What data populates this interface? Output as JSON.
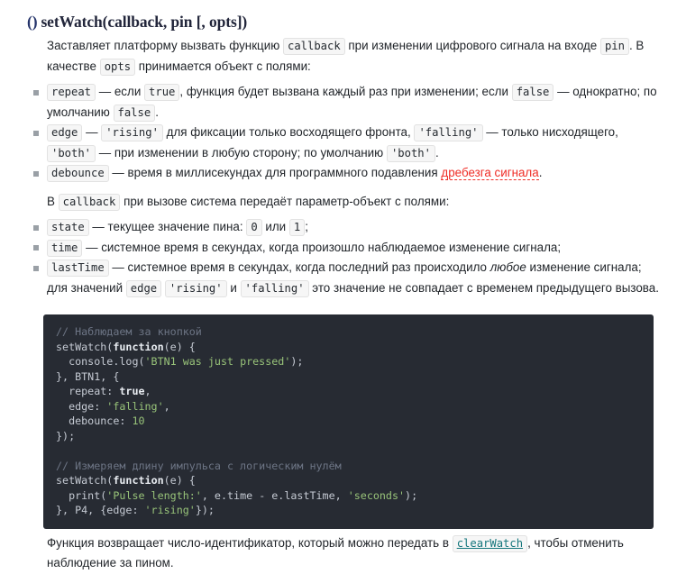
{
  "heading": {
    "paren": "()",
    "title": "setWatch(callback, pin [, opts])"
  },
  "intro": {
    "t1": "Заставляет платформу вызвать функцию ",
    "code_callback": "callback",
    "t2": " при изменении цифрового сигнала на входе ",
    "code_pin": "pin",
    "t3": ". В качестве ",
    "code_opts": "opts",
    "t4": " принимается объект с полями:"
  },
  "opts_list": [
    {
      "code": "repeat",
      "t1": " — если ",
      "code2": "true",
      "t2": ", функция будет вызвана каждый раз при изменении; если ",
      "code3": "false",
      "t3": " — однократно; по умолчанию ",
      "code4": "false",
      "t4": "."
    },
    {
      "code": "edge",
      "t1": " — ",
      "code2": "'rising'",
      "t2": " для фиксации только восходящего фронта, ",
      "code3": "'falling'",
      "t3": " — только нисходящего, ",
      "code4": "'both'",
      "t4": " — при изменении в любую сторону; по умолчанию ",
      "code5": "'both'",
      "t5": "."
    },
    {
      "code": "debounce",
      "t1": " — время в миллисекундах для программного подавления ",
      "link": "дребезга сигнала",
      "t2": "."
    }
  ],
  "callback_intro": {
    "t1": "В ",
    "code": "callback",
    "t2": " при вызове система передаёт параметр-объект с полями:"
  },
  "params_list": [
    {
      "code": "state",
      "t1": " — текущее значение пина: ",
      "code2": "0",
      "t2": " или ",
      "code3": "1",
      "t3": ";"
    },
    {
      "code": "time",
      "t1": " — системное время в секундах, когда произошло наблюдаемое изменение сигнала;"
    },
    {
      "code": "lastTime",
      "t1": " — системное время в секундах, когда последний раз происходило ",
      "em": "любое",
      "t2": " изменение сигнала; для значений ",
      "code2": "edge",
      "t3": " ",
      "code3": "'rising'",
      "t4": " и ",
      "code4": "'falling'",
      "t5": " это значение не совпадает с временем предыдущего вызова."
    }
  ],
  "code_block": {
    "lines": [
      [
        {
          "t": "// Наблюдаем за кнопкой",
          "c": "tok-com"
        }
      ],
      [
        {
          "t": "setWatch(",
          "c": "tok-pln"
        },
        {
          "t": "function",
          "c": "tok-kw"
        },
        {
          "t": "(e) {",
          "c": "tok-pln"
        }
      ],
      [
        {
          "t": "  console.log(",
          "c": "tok-pln"
        },
        {
          "t": "'BTN1 was just pressed'",
          "c": "tok-str"
        },
        {
          "t": ");",
          "c": "tok-pln"
        }
      ],
      [
        {
          "t": "}, BTN1, {",
          "c": "tok-pln"
        }
      ],
      [
        {
          "t": "  repeat: ",
          "c": "tok-pln"
        },
        {
          "t": "true",
          "c": "tok-kw"
        },
        {
          "t": ",",
          "c": "tok-pln"
        }
      ],
      [
        {
          "t": "  edge: ",
          "c": "tok-pln"
        },
        {
          "t": "'falling'",
          "c": "tok-str"
        },
        {
          "t": ",",
          "c": "tok-pln"
        }
      ],
      [
        {
          "t": "  debounce: ",
          "c": "tok-pln"
        },
        {
          "t": "10",
          "c": "tok-num"
        }
      ],
      [
        {
          "t": "});",
          "c": "tok-pln"
        }
      ],
      [
        {
          "t": "",
          "c": "tok-pln"
        }
      ],
      [
        {
          "t": "// Измеряем длину импульса с логическим нулём",
          "c": "tok-com"
        }
      ],
      [
        {
          "t": "setWatch(",
          "c": "tok-pln"
        },
        {
          "t": "function",
          "c": "tok-kw"
        },
        {
          "t": "(e) {",
          "c": "tok-pln"
        }
      ],
      [
        {
          "t": "  print(",
          "c": "tok-pln"
        },
        {
          "t": "'Pulse length:'",
          "c": "tok-str"
        },
        {
          "t": ", e.time - e.lastTime, ",
          "c": "tok-pln"
        },
        {
          "t": "'seconds'",
          "c": "tok-str"
        },
        {
          "t": ");",
          "c": "tok-pln"
        }
      ],
      [
        {
          "t": "}, P4, {edge: ",
          "c": "tok-pln"
        },
        {
          "t": "'rising'",
          "c": "tok-str"
        },
        {
          "t": "});",
          "c": "tok-pln"
        }
      ]
    ]
  },
  "outro": {
    "t1": "Функция возвращает число-идентификатор, который можно передать в ",
    "link": "clearWatch",
    "t2": ", чтобы отменить наблюдение за пином."
  },
  "colors": {
    "code_bg": "#272b33",
    "inline_code_bg": "#f6f6f6",
    "link_teal": "#14767c",
    "link_red": "#ef2d26",
    "heading": "#21253a",
    "paren_blue": "#25346b",
    "string_green": "#98c379",
    "comment_gray": "#6d7585"
  }
}
